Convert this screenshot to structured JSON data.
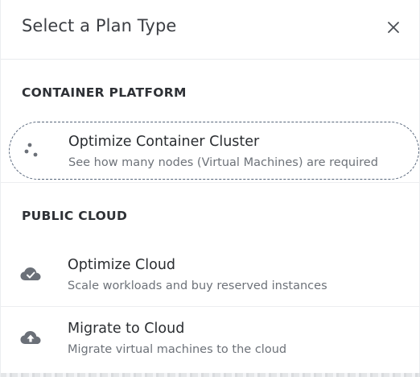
{
  "dialog": {
    "title": "Select a Plan Type",
    "close_icon": "close-icon"
  },
  "sections": [
    {
      "title": "CONTAINER PLATFORM",
      "items": [
        {
          "label": "Optimize Container Cluster",
          "description": "See how many nodes (Virtual Machines) are required",
          "icon": "container-cluster-icon",
          "selected": true
        }
      ]
    },
    {
      "title": "PUBLIC CLOUD",
      "items": [
        {
          "label": "Optimize Cloud",
          "description": "Scale workloads and buy reserved instances",
          "icon": "cloud-check-icon",
          "selected": false
        },
        {
          "label": "Migrate to Cloud",
          "description": "Migrate virtual machines to the cloud",
          "icon": "cloud-upload-icon",
          "selected": false
        }
      ]
    }
  ],
  "colors": {
    "icon_gray": "#6b7078",
    "selected_border": "#56657a"
  }
}
